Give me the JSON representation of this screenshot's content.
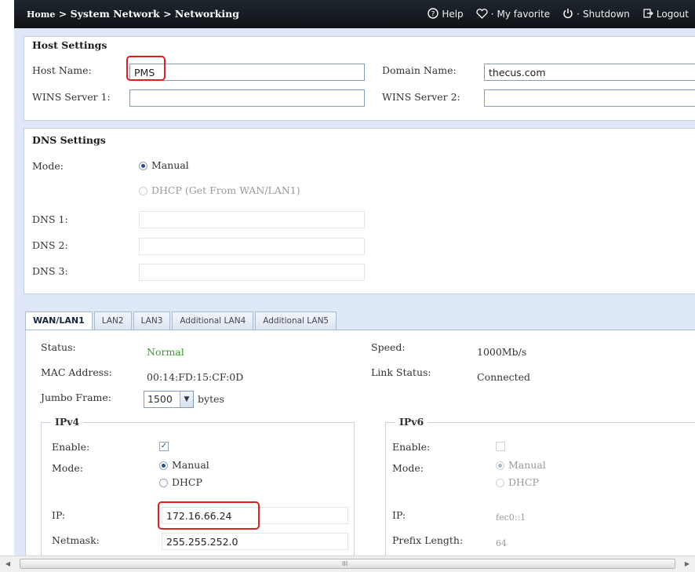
{
  "breadcrumb": {
    "home": "Home",
    "sep1": ">",
    "system": "System Network",
    "sep2": ">",
    "page": "Networking"
  },
  "top_links": {
    "help": "Help",
    "favorite": "My favorite",
    "shutdown": "Shutdown",
    "logout": "Logout",
    "help_icon": "help-circle-icon",
    "favorite_icon": "heart-icon",
    "shutdown_icon": "power-icon",
    "logout_icon": "logout-icon"
  },
  "host": {
    "title": "Host Settings",
    "host_name_label": "Host Name:",
    "host_name_value": "PMS",
    "domain_name_label": "Domain Name:",
    "domain_name_value": "thecus.com",
    "wins1_label": "WINS Server 1:",
    "wins1_value": "",
    "wins2_label": "WINS Server 2:",
    "wins2_value": ""
  },
  "dns": {
    "title": "DNS Settings",
    "mode_label": "Mode:",
    "manual_label": "Manual",
    "dhcp_label": "DHCP (Get From WAN/LAN1)",
    "dns1_label": "DNS 1:",
    "dns2_label": "DNS 2:",
    "dns3_label": "DNS 3:",
    "dns1_value": "",
    "dns2_value": "",
    "dns3_value": ""
  },
  "tabs": [
    "WAN/LAN1",
    "LAN2",
    "LAN3",
    "Additional LAN4",
    "Additional LAN5"
  ],
  "wan": {
    "status_label": "Status:",
    "status_value": "Normal",
    "speed_label": "Speed:",
    "speed_value": "1000Mb/s",
    "mac_label": "MAC Address:",
    "mac_value": "00:14:FD:15:CF:0D",
    "link_label": "Link Status:",
    "link_value": "Connected",
    "jumbo_label": "Jumbo Frame:",
    "jumbo_value": "1500",
    "jumbo_unit": "bytes"
  },
  "ipv4": {
    "title": "IPv4",
    "enable_label": "Enable:",
    "mode_label": "Mode:",
    "manual_label": "Manual",
    "dhcp_label": "DHCP",
    "ip_label": "IP:",
    "ip_value": "172.16.66.24",
    "netmask_label": "Netmask:",
    "netmask_value": "255.255.252.0"
  },
  "ipv6": {
    "title": "IPv6",
    "enable_label": "Enable:",
    "mode_label": "Mode:",
    "manual_label": "Manual",
    "dhcp_label": "DHCP",
    "ip_label": "IP:",
    "ip_value": "fec0::1",
    "prefix_label": "Prefix Length:",
    "prefix_value": "64"
  },
  "scrollbar": {
    "grip": "III"
  },
  "colors": {
    "highlight": "#e0201f",
    "status_ok": "#3a9b2c",
    "topbar": "#141a20",
    "panel_bg": "#dfe8f6"
  }
}
